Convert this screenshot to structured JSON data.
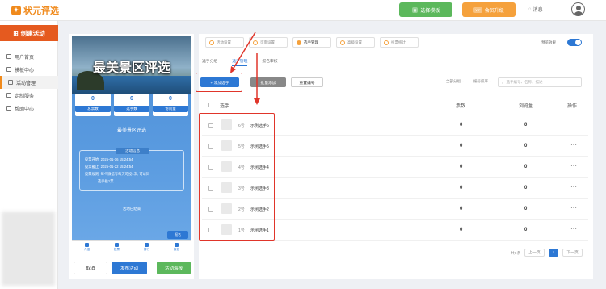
{
  "header": {
    "logo_text": "状元评选",
    "template_button": "选择模板",
    "vip_button": "会员升级",
    "vip_badge": "VIP",
    "messages": "消息"
  },
  "sidebar": {
    "create_button": "创建活动",
    "items": [
      {
        "label": "用户首页"
      },
      {
        "label": "模板中心"
      },
      {
        "label": "活动管理"
      },
      {
        "label": "定制服务"
      },
      {
        "label": "帮助中心"
      }
    ]
  },
  "phone_preview": {
    "banner_title": "最美景区评选",
    "stats": [
      {
        "value": "0",
        "label": "总票数"
      },
      {
        "value": "6",
        "label": "选手数"
      },
      {
        "value": "0",
        "label": "访问量"
      }
    ],
    "activity_name": "最美景区评选",
    "info_header": "活动信息",
    "info_lines": [
      "投票开始: 2025-01-16 15:24:54",
      "投票截止: 2025-01-22 15:24:54",
      "投票规则: 每个微信号每天可投1次, 可以同一",
      "选手投1票"
    ],
    "live_text": "活动已结束",
    "float_button": "报名",
    "tabs": [
      "介绍",
      "投票",
      "排行",
      "报名"
    ],
    "buttons": {
      "cancel": "取消",
      "publish": "发布活动",
      "poster": "活动海报"
    }
  },
  "main": {
    "steps": [
      {
        "label": "活动设置"
      },
      {
        "label": "页面设置"
      },
      {
        "label": "选手管理"
      },
      {
        "label": "高级设置"
      },
      {
        "label": "投票统计"
      }
    ],
    "toggle_label": "预览效果",
    "subtabs": [
      "选手分组",
      "选手管理",
      "报名审核"
    ],
    "actions": {
      "add_player": "+ 添加选手",
      "batch_add": "批量添加",
      "renumber": "重置编号",
      "group_filter": "全部分组",
      "sort_filter": "编号排序",
      "search_placeholder": "选手编号、名称、描述"
    },
    "table": {
      "headers": [
        "选手",
        "票数",
        "浏览量",
        "操作"
      ],
      "rows": [
        {
          "num": "6号",
          "name": "示例选手6",
          "votes": "0",
          "views": "0"
        },
        {
          "num": "5号",
          "name": "示例选手5",
          "votes": "0",
          "views": "0"
        },
        {
          "num": "4号",
          "name": "示例选手4",
          "votes": "0",
          "views": "0"
        },
        {
          "num": "3号",
          "name": "示例选手3",
          "votes": "0",
          "views": "0"
        },
        {
          "num": "2号",
          "name": "示例选手2",
          "votes": "0",
          "views": "0"
        },
        {
          "num": "1号",
          "name": "示例选手1",
          "votes": "0",
          "views": "0"
        }
      ],
      "more_icon": "···"
    },
    "pager": {
      "total": "共6条",
      "prev": "上一页",
      "current": "1",
      "next": "下一页"
    }
  },
  "colors": {
    "accent": "#2d78d4",
    "brand": "#f08a1c",
    "highlight": "#e0352a"
  }
}
